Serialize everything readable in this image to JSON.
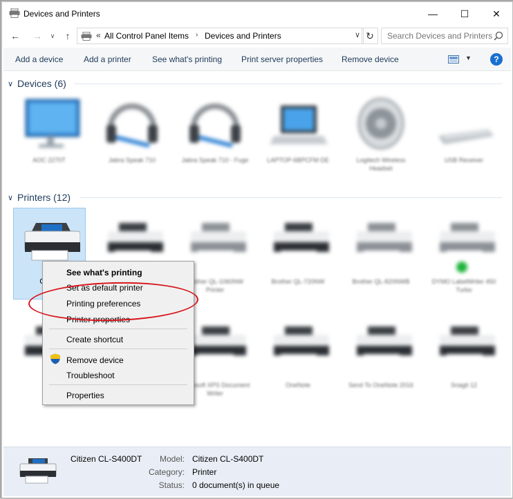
{
  "window": {
    "title": "Devices and Printers",
    "controls": {
      "minimize": "—",
      "maximize": "☐",
      "close": "✕"
    }
  },
  "address": {
    "overflow": "«",
    "crumbs": [
      "All Control Panel Items",
      "Devices and Printers"
    ],
    "search_placeholder": "Search Devices and Printers"
  },
  "commands": [
    "Add a device",
    "Add a printer",
    "See what's printing",
    "Print server properties",
    "Remove device"
  ],
  "groups": {
    "devices": {
      "label": "Devices (6)"
    },
    "printers": {
      "label": "Printers (12)"
    }
  },
  "devices": [
    {
      "label": "AOC 2270T",
      "icon": "monitor-icon"
    },
    {
      "label": "Jabra Speak 710",
      "icon": "headset-icon"
    },
    {
      "label": "Jabra Speak 710 - Fuge",
      "icon": "headset-icon"
    },
    {
      "label": "LAPTOP-6BPCFM DE",
      "icon": "laptop-icon"
    },
    {
      "label": "Logitech Wireless Headset",
      "icon": "speaker-icon"
    },
    {
      "label": "USB Receiver",
      "icon": "keyboard-icon"
    }
  ],
  "printers_row1": [
    {
      "label": "Ci CL",
      "selected": true
    },
    {
      "label": "",
      "selected": false
    },
    {
      "label": "Brother QL-1060NW Printer",
      "selected": false
    },
    {
      "label": "Brother QL-720NW",
      "selected": false
    },
    {
      "label": "Brother QL-820NWB",
      "selected": false
    },
    {
      "label": "DYMO LabelWriter 450 Turbo",
      "selected": false,
      "status_color": "#1db33a"
    }
  ],
  "printers_row2": [
    {
      "label": ""
    },
    {
      "label": ""
    },
    {
      "label": "Microsoft XPS Document Writer"
    },
    {
      "label": "OneNote"
    },
    {
      "label": "Send To OneNote 2016"
    },
    {
      "label": "Snagit 12"
    }
  ],
  "context_menu": {
    "items": [
      "See what's printing",
      "Set as default printer",
      "Printing preferences",
      "Printer properties",
      "Create shortcut",
      "Remove device",
      "Troubleshoot",
      "Properties"
    ],
    "highlight_color": "#d7141a"
  },
  "details": {
    "name": "Citizen CL-S400DT",
    "model_key": "Model:",
    "model": "Citizen CL-S400DT",
    "category_key": "Category:",
    "category": "Printer",
    "status_key": "Status:",
    "status": "0 document(s) in queue"
  },
  "colors": {
    "accent": "#1e395b",
    "help": "#1a6fd1",
    "selection": "#cce4f7"
  }
}
